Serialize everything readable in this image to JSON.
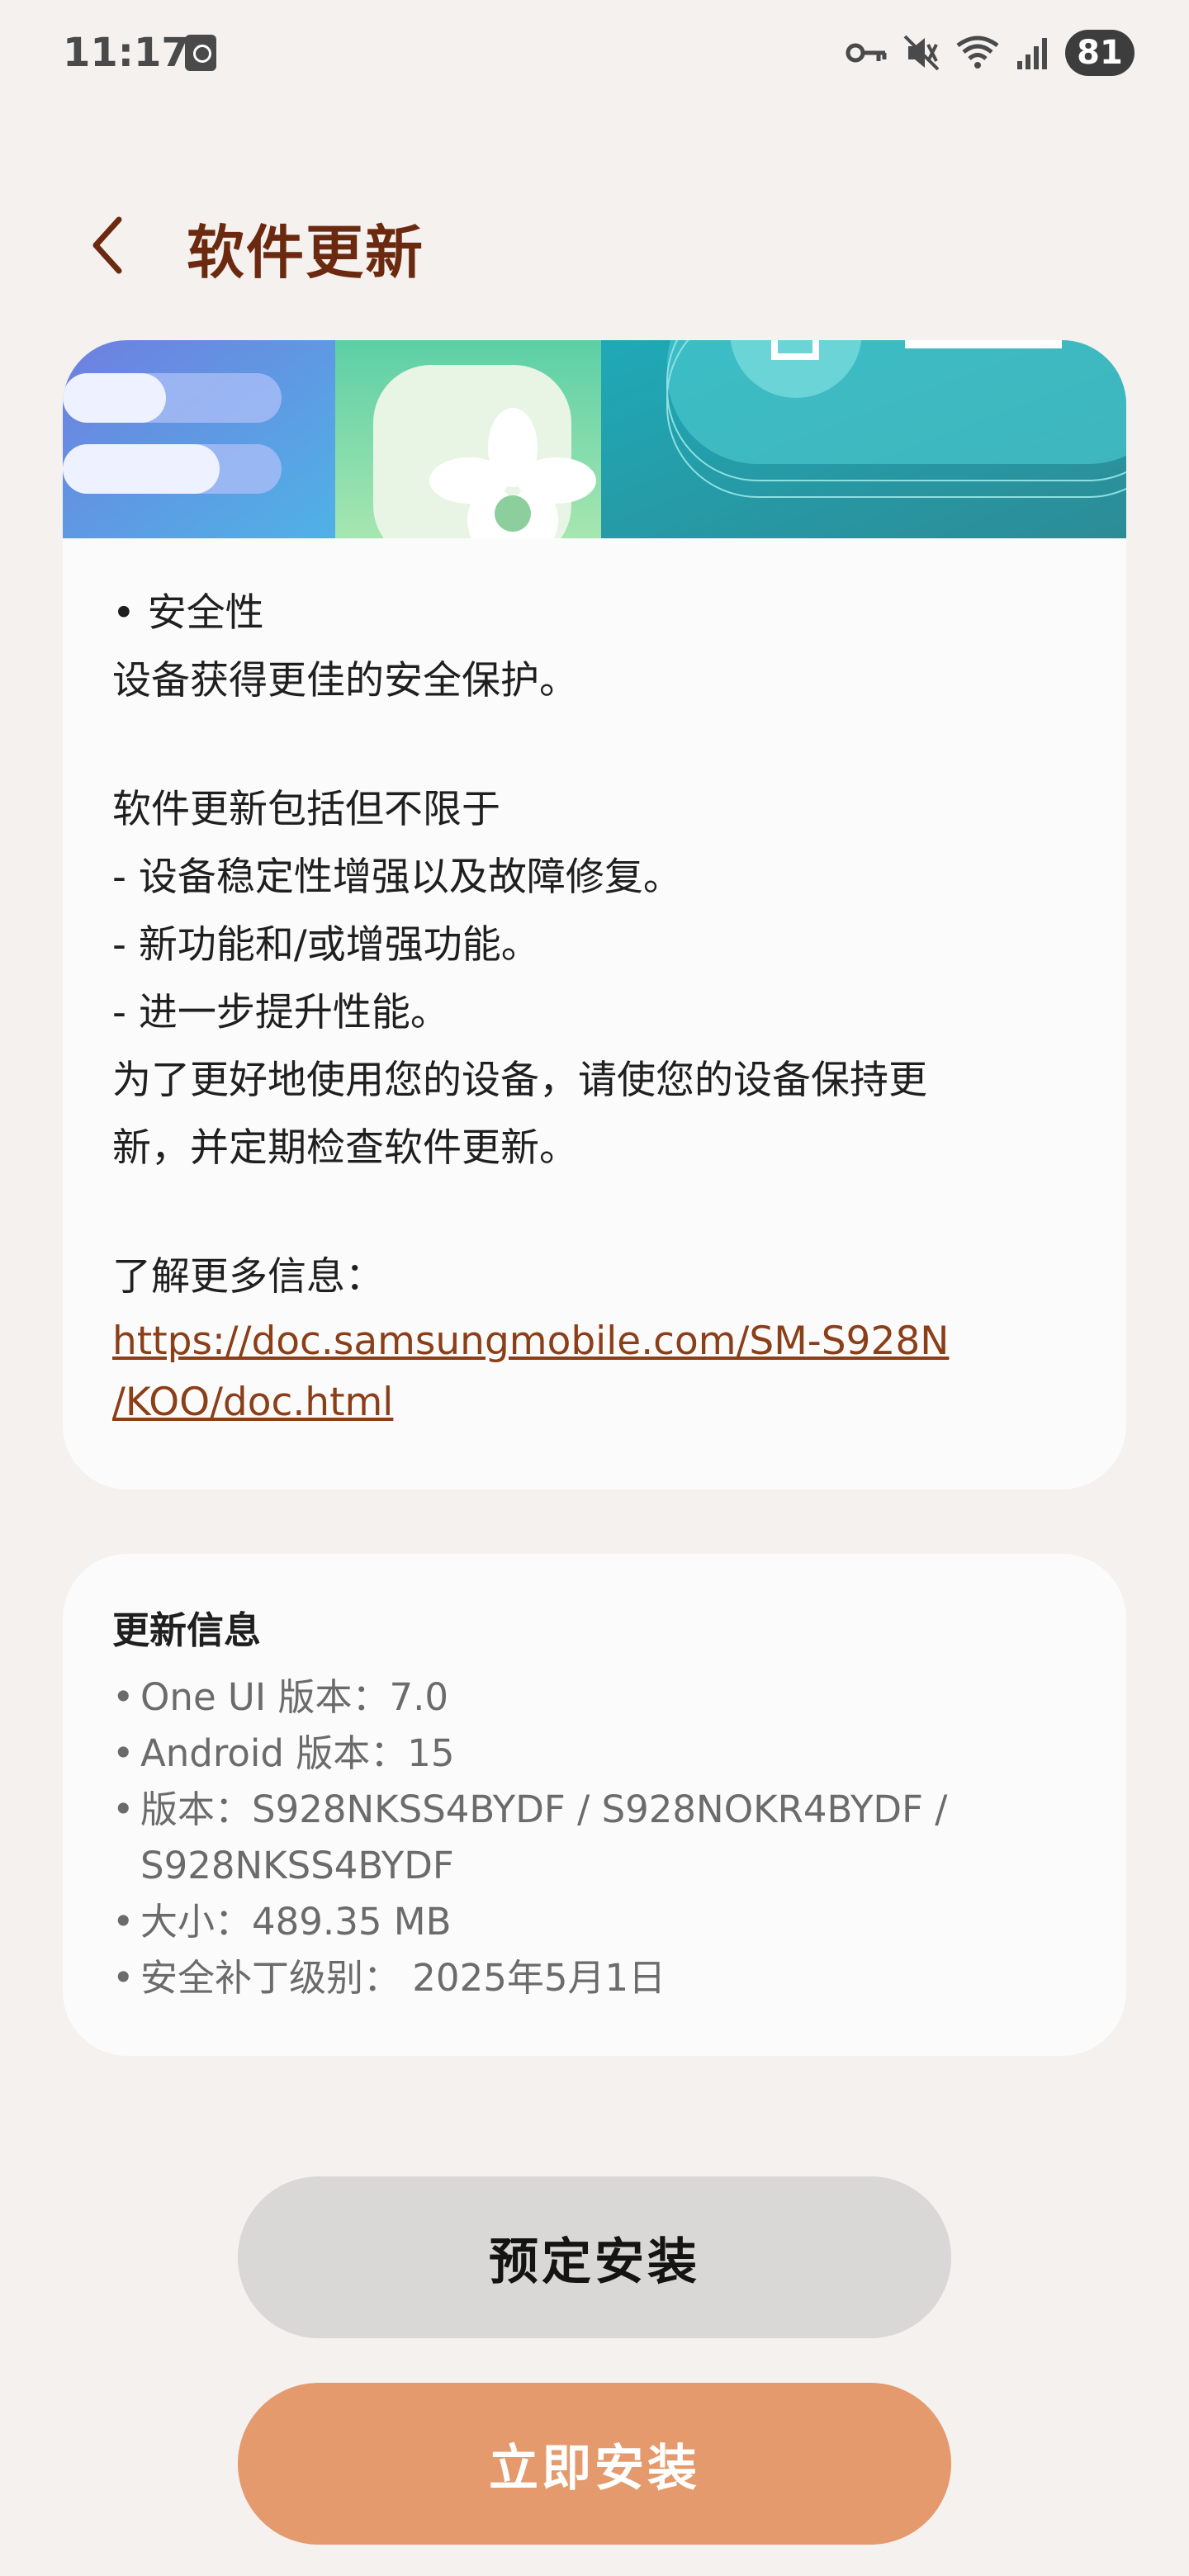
{
  "status_bar": {
    "time": "11:17",
    "battery": "81",
    "icons": [
      "clock-app-icon",
      "vpn-key-icon",
      "mute-icon",
      "wifi-icon",
      "signal-icon"
    ]
  },
  "header": {
    "back_icon": "chevron-left-icon",
    "title": "软件更新"
  },
  "release_notes": {
    "lines": [
      "• 安全性",
      "设备获得更佳的安全保护。",
      "",
      "软件更新包括但不限于",
      "- 设备稳定性增强以及故障修复。",
      "- 新功能和/或增强功能。",
      "- 进一步提升性能。",
      "为了更好地使用您的设备，请使您的设备保持更",
      "新，并定期检查软件更新。",
      "",
      "了解更多信息："
    ],
    "link_line1": "https://doc.samsungmobile.com/SM-S928N",
    "link_line2": "/KOO/doc.html"
  },
  "update_info": {
    "title": "更新信息",
    "items": [
      "One UI 版本：7.0",
      "Android 版本：15",
      "版本：S928NKSS4BYDF / S928NOKR4BYDF / S928NKSS4BYDF",
      "大小：489.35 MB",
      "安全补丁级别： 2025年5月1日"
    ]
  },
  "buttons": {
    "schedule_label": "预定安装",
    "install_label": "立即安装"
  },
  "colors": {
    "title": "#6b2a10",
    "link": "#8b3f19",
    "install_button": "#e49a6c",
    "schedule_button": "#dad8d6",
    "background": "#f4f1ef"
  }
}
